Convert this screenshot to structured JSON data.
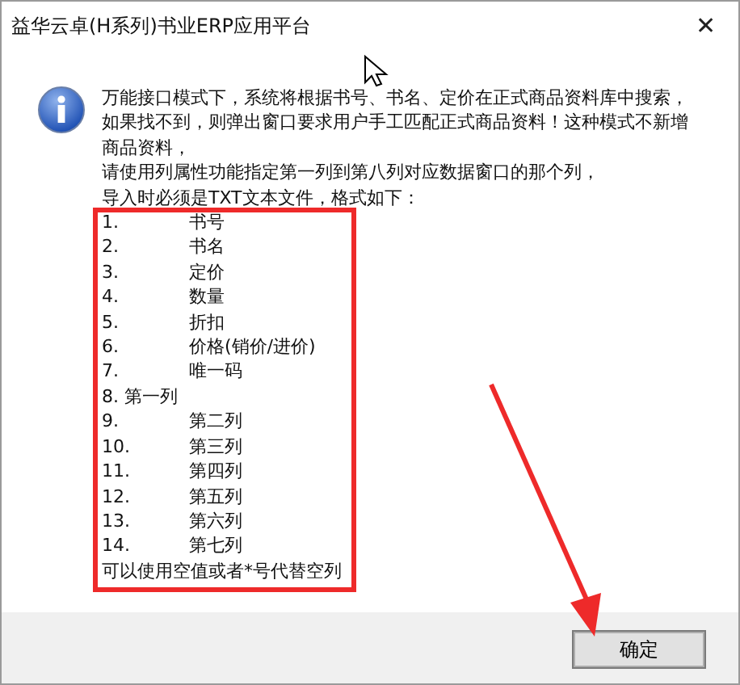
{
  "window": {
    "title": "益华云卓(H系列)书业ERP应用平台",
    "close": "✕"
  },
  "message": {
    "lines": [
      "万能接口模式下，系统将根据书号、书名、定价在正式商品资料库中搜索，",
      "如果找不到，则弹出窗口要求用户手工匹配正式商品资料！这种模式不新增商品资料，",
      "请使用列属性功能指定第一列到第八列对应数据窗口的那个列，",
      "导入时必须是TXT文本文件，格式如下："
    ],
    "items": [
      {
        "kind": "column",
        "number": "1.",
        "text": "书号"
      },
      {
        "kind": "column",
        "number": "2.",
        "text": "书名"
      },
      {
        "kind": "column",
        "number": "3.",
        "text": "定价"
      },
      {
        "kind": "column",
        "number": "4.",
        "text": "数量"
      },
      {
        "kind": "column",
        "number": "5.",
        "text": "折扣"
      },
      {
        "kind": "column",
        "number": "6.",
        "text": "价格(销价/进价)"
      },
      {
        "kind": "column",
        "number": "7.",
        "text": "唯一码"
      },
      {
        "kind": "inline",
        "number": "8.",
        "text": "第一列"
      },
      {
        "kind": "column",
        "number": "9.",
        "text": "第二列"
      },
      {
        "kind": "column",
        "number": "10.",
        "text": "第三列"
      },
      {
        "kind": "column",
        "number": "11.",
        "text": "第四列"
      },
      {
        "kind": "column",
        "number": "12.",
        "text": "第五列"
      },
      {
        "kind": "column",
        "number": "13.",
        "text": "第六列"
      },
      {
        "kind": "column",
        "number": "14.",
        "text": "第七列"
      }
    ],
    "footnote": "可以使用空值或者*号代替空列"
  },
  "buttons": [
    {
      "label": "确定"
    }
  ]
}
